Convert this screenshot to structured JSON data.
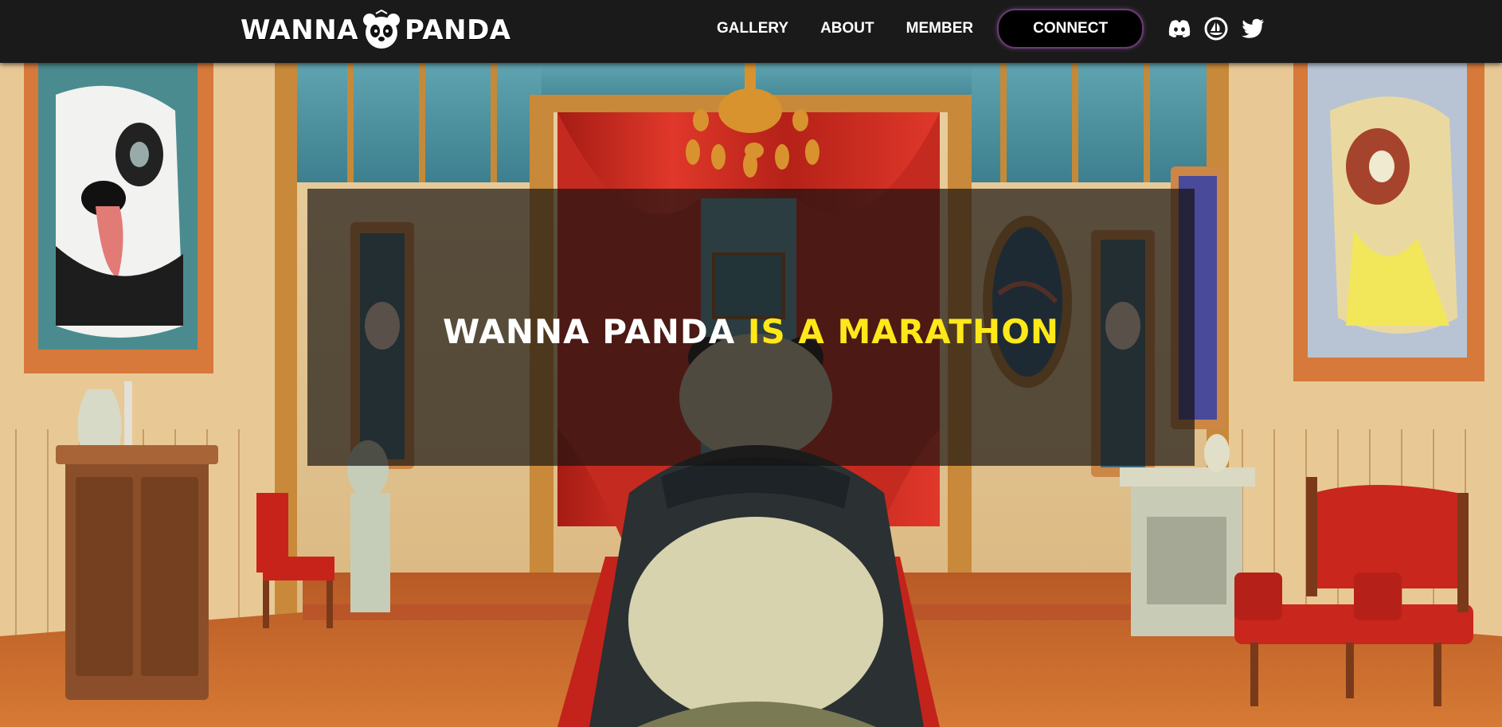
{
  "brand": {
    "logo_left": "WANNA",
    "logo_right": "PANDA"
  },
  "nav": {
    "items": [
      {
        "label": "GALLERY"
      },
      {
        "label": "ABOUT"
      },
      {
        "label": "MEMBER"
      }
    ],
    "connect_label": "CONNECT"
  },
  "social": [
    {
      "icon": "discord-icon"
    },
    {
      "icon": "opensea-icon"
    },
    {
      "icon": "twitter-icon"
    }
  ],
  "hero": {
    "headline_white": "WANNA PANDA",
    "headline_yellow": "IS A MARATHON"
  },
  "colors": {
    "topbar": "#1a1a1a",
    "accent_yellow": "#ffe81a",
    "connect_border": "#6a3b72",
    "curtain_red": "#c9271c",
    "floor_orange": "#c9672a"
  }
}
